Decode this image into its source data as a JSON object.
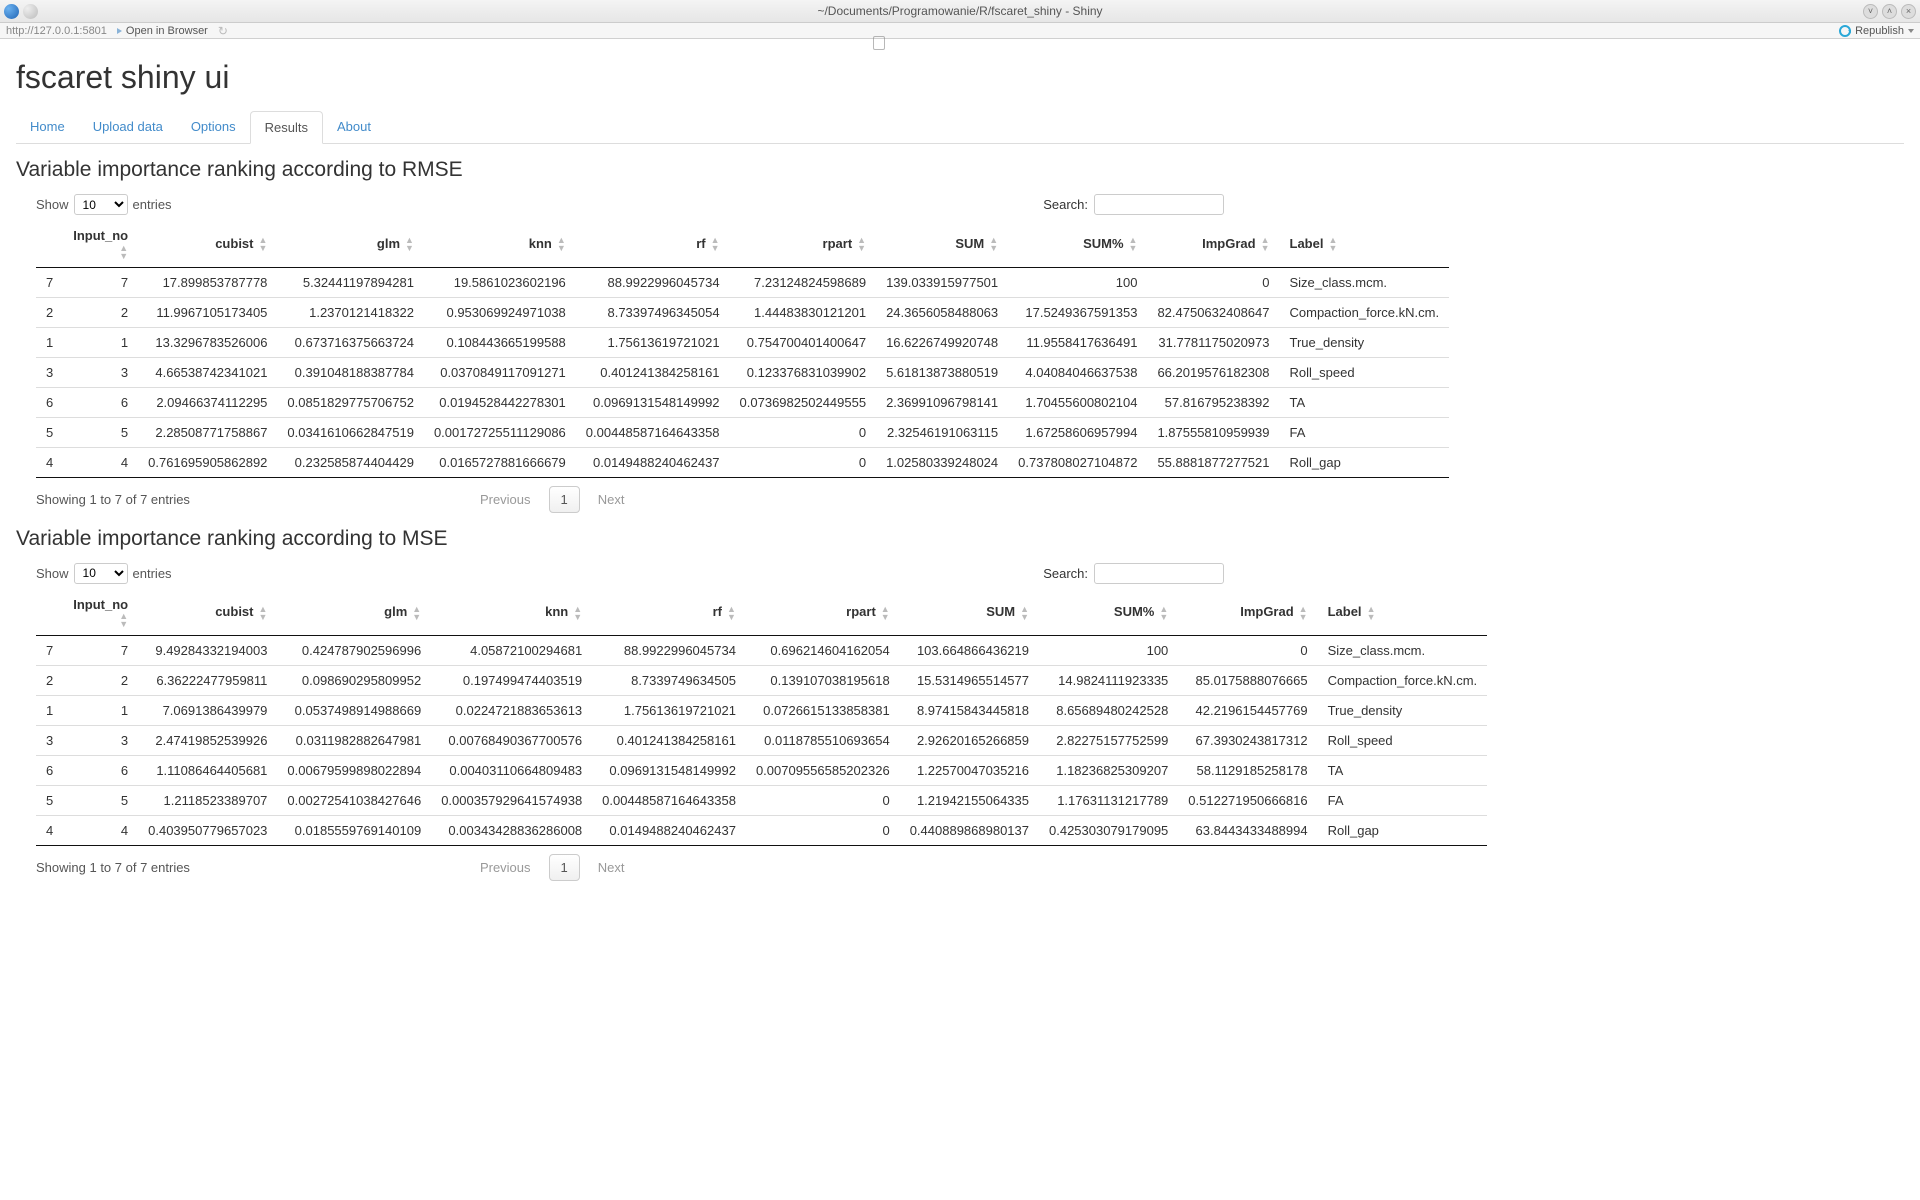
{
  "window_title": "~/Documents/Programowanie/R/fscaret_shiny - Shiny",
  "url": "http://127.0.0.1:5801",
  "open_in_browser": "Open in Browser",
  "republish": "Republish",
  "page_title": "fscaret shiny ui",
  "tabs": [
    "Home",
    "Upload data",
    "Options",
    "Results",
    "About"
  ],
  "active_tab": 3,
  "show_label_pre": "Show",
  "show_label_post": "entries",
  "show_value": "10",
  "search_label": "Search:",
  "sections": {
    "rmse": {
      "title": "Variable importance ranking according to RMSE",
      "columns": [
        "",
        "Input_no",
        "cubist",
        "glm",
        "knn",
        "rf",
        "rpart",
        "SUM",
        "SUM%",
        "ImpGrad",
        "Label"
      ],
      "rows": [
        [
          "7",
          "7",
          "17.899853787778",
          "5.32441197894281",
          "19.5861023602196",
          "88.9922996045734",
          "7.23124824598689",
          "139.033915977501",
          "100",
          "0",
          "Size_class.mcm."
        ],
        [
          "2",
          "2",
          "11.9967105173405",
          "1.2370121418322",
          "0.953069924971038",
          "8.73397496345054",
          "1.44483830121201",
          "24.3656058488063",
          "17.5249367591353",
          "82.4750632408647",
          "Compaction_force.kN.cm."
        ],
        [
          "1",
          "1",
          "13.3296783526006",
          "0.673716375663724",
          "0.108443665199588",
          "1.75613619721021",
          "0.754700401400647",
          "16.6226749920748",
          "11.9558417636491",
          "31.7781175020973",
          "True_density"
        ],
        [
          "3",
          "3",
          "4.66538742341021",
          "0.391048188387784",
          "0.0370849117091271",
          "0.401241384258161",
          "0.123376831039902",
          "5.61813873880519",
          "4.04084046637538",
          "66.2019576182308",
          "Roll_speed"
        ],
        [
          "6",
          "6",
          "2.09466374112295",
          "0.0851829775706752",
          "0.0194528442278301",
          "0.0969131548149992",
          "0.0736982502449555",
          "2.36991096798141",
          "1.70455600802104",
          "57.816795238392",
          "TA"
        ],
        [
          "5",
          "5",
          "2.28508771758867",
          "0.0341610662847519",
          "0.00172725511129086",
          "0.00448587164643358",
          "0",
          "2.32546191063115",
          "1.67258606957994",
          "1.87555810959939",
          "FA"
        ],
        [
          "4",
          "4",
          "0.761695905862892",
          "0.232585874404429",
          "0.0165727881666679",
          "0.0149488240462437",
          "0",
          "1.02580339248024",
          "0.737808027104872",
          "55.8881877277521",
          "Roll_gap"
        ]
      ],
      "info": "Showing 1 to 7 of 7 entries",
      "prev": "Previous",
      "page": "1",
      "next": "Next"
    },
    "mse": {
      "title": "Variable importance ranking according to MSE",
      "columns": [
        "",
        "Input_no",
        "cubist",
        "glm",
        "knn",
        "rf",
        "rpart",
        "SUM",
        "SUM%",
        "ImpGrad",
        "Label"
      ],
      "rows": [
        [
          "7",
          "7",
          "9.49284332194003",
          "0.424787902596996",
          "4.05872100294681",
          "88.9922996045734",
          "0.696214604162054",
          "103.664866436219",
          "100",
          "0",
          "Size_class.mcm."
        ],
        [
          "2",
          "2",
          "6.36222477959811",
          "0.098690295809952",
          "0.197499474403519",
          "8.7339749634505",
          "0.139107038195618",
          "15.5314965514577",
          "14.9824111923335",
          "85.0175888076665",
          "Compaction_force.kN.cm."
        ],
        [
          "1",
          "1",
          "7.0691386439979",
          "0.0537498914988669",
          "0.0224721883653613",
          "1.75613619721021",
          "0.0726615133858381",
          "8.97415843445818",
          "8.65689480242528",
          "42.2196154457769",
          "True_density"
        ],
        [
          "3",
          "3",
          "2.47419852539926",
          "0.0311982882647981",
          "0.00768490367700576",
          "0.401241384258161",
          "0.0118785510693654",
          "2.92620165266859",
          "2.82275157752599",
          "67.3930243817312",
          "Roll_speed"
        ],
        [
          "6",
          "6",
          "1.11086464405681",
          "0.00679599898022894",
          "0.00403110664809483",
          "0.0969131548149992",
          "0.00709556585202326",
          "1.22570047035216",
          "1.18236825309207",
          "58.1129185258178",
          "TA"
        ],
        [
          "5",
          "5",
          "1.2118523389707",
          "0.00272541038427646",
          "0.000357929641574938",
          "0.00448587164643358",
          "0",
          "1.21942155064335",
          "1.17631131217789",
          "0.512271950666816",
          "FA"
        ],
        [
          "4",
          "4",
          "0.403950779657023",
          "0.0185559769140109",
          "0.00343428836286008",
          "0.0149488240462437",
          "0",
          "0.440889868980137",
          "0.425303079179095",
          "63.8443433488994",
          "Roll_gap"
        ]
      ],
      "info": "Showing 1 to 7 of 7 entries",
      "prev": "Previous",
      "page": "1",
      "next": "Next"
    }
  }
}
